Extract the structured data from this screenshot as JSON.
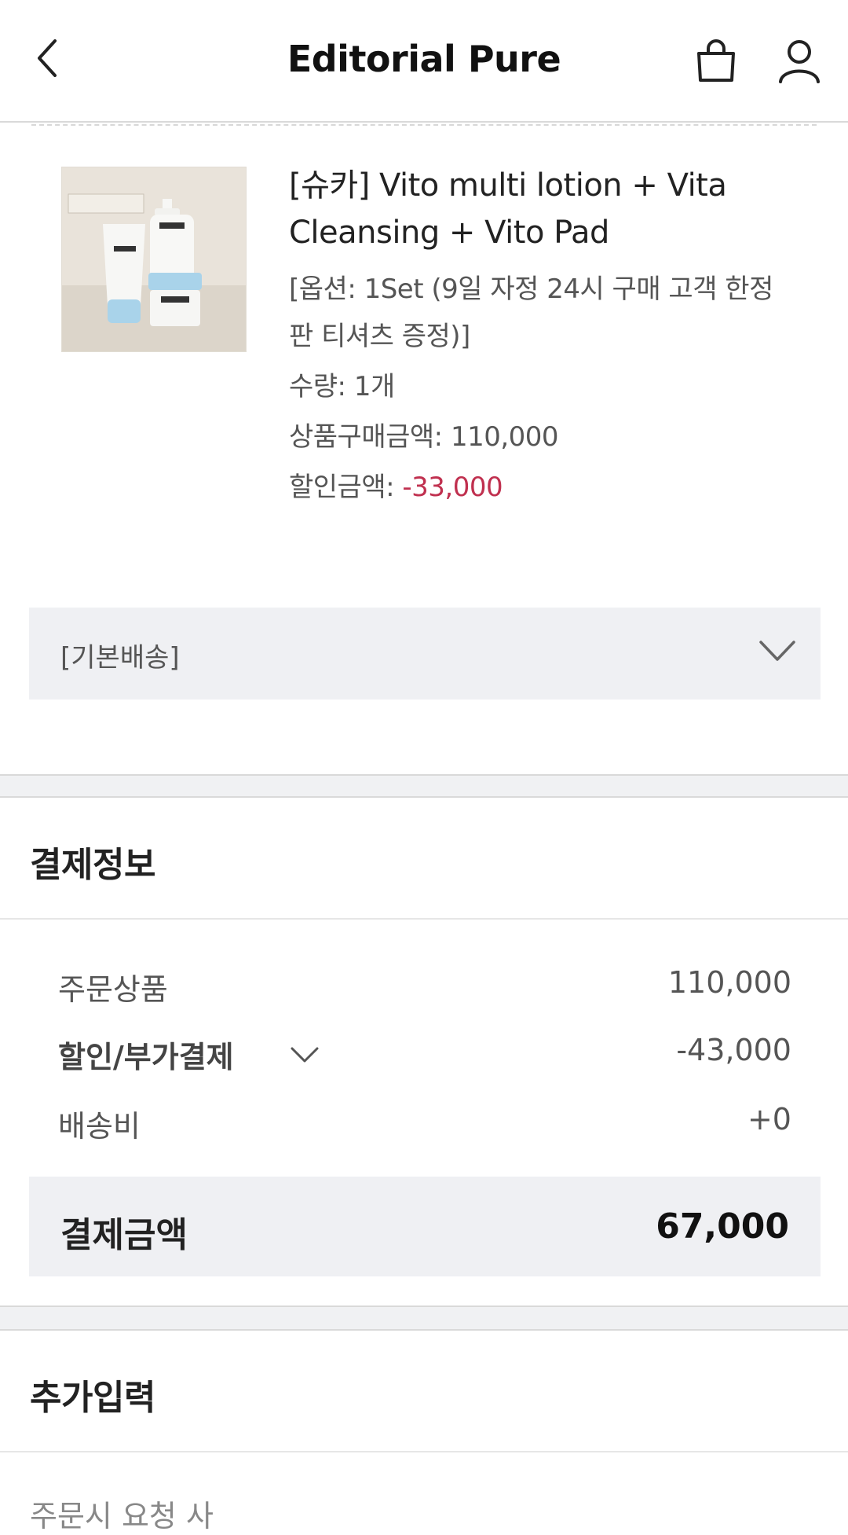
{
  "header": {
    "title": "Editorial Pure",
    "back_icon": "chevron-left-icon",
    "cart_icon": "shopping-bag-icon",
    "user_icon": "user-icon"
  },
  "product": {
    "image_alt": "E'SYU product set",
    "name": "[슈카] Vito multi lotion + Vita Cleansing + Vito Pad",
    "option": "[옵션: 1Set (9일 자정 24시 구매 고객 한정판 티셔츠 증정)]",
    "quantity": "수량: 1개",
    "price_label": "상품구매금액: 110,000",
    "discount_label": "할인금액: ",
    "discount_value": "-33,000"
  },
  "shipping": {
    "label": "[기본배송]",
    "toggle_icon": "chevron-down-icon"
  },
  "payment": {
    "title": "결제정보",
    "rows": [
      {
        "label": "주문상품",
        "value": "110,000"
      },
      {
        "label": "할인/부가결제",
        "value": "-43,000"
      },
      {
        "label": "배송비",
        "value": "+0"
      }
    ],
    "total_label": "결제금액",
    "total_value": "67,000"
  },
  "extra": {
    "title": "추가입력",
    "request_label": "주문시 요청 사"
  },
  "colors": {
    "discount": "#c0304f",
    "box_bg": "#eff0f3"
  }
}
